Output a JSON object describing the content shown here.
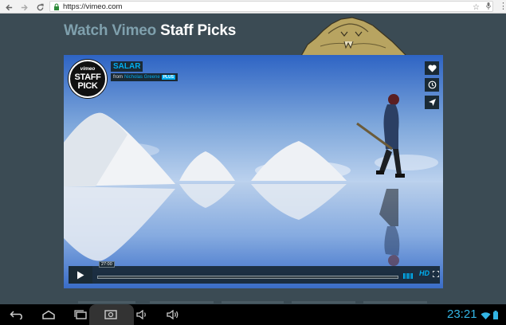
{
  "browser": {
    "url": "https://vimeo.com",
    "icons": [
      "back-icon",
      "forward-icon",
      "reload-icon",
      "lock-icon",
      "star-icon",
      "mic-icon",
      "menu-icon"
    ]
  },
  "page": {
    "title_prefix": "Watch Vimeo",
    "title_suffix": "Staff Picks"
  },
  "video": {
    "badge": {
      "brand": "vimeo",
      "line1": "STAFF",
      "line2": "PICK"
    },
    "title": "SALAR",
    "byline_prefix": "from",
    "author": "Nicholas Greene",
    "author_badge": "PLUS",
    "time": "27:00",
    "hd_label": "HD",
    "progress": 0.0,
    "side_buttons": [
      "like-icon",
      "watch-later-icon",
      "share-icon"
    ]
  },
  "system_bar": {
    "clock": "23:21",
    "buttons": [
      "back-icon",
      "home-icon",
      "recents-icon",
      "screenshot-icon",
      "volume-down-icon",
      "volume-up-icon"
    ],
    "colors": {
      "accent": "#33b5e5"
    }
  },
  "colors": {
    "page_bg": "#3b4b54",
    "vimeo_blue": "#00adef",
    "title_muted": "#7fa0ad"
  }
}
